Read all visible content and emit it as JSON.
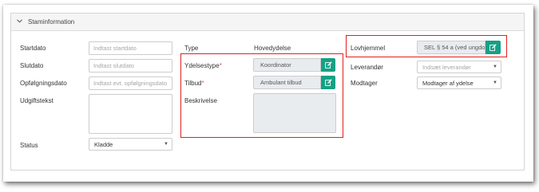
{
  "panel": {
    "title": "Staminformation"
  },
  "left": {
    "startdato": {
      "label": "Startdato",
      "placeholder": "Indtast startdato"
    },
    "slutdato": {
      "label": "Slutdato",
      "placeholder": "Indtast slutdato"
    },
    "opfolgning": {
      "label": "Opfølgningsdato",
      "placeholder": "Indtast evt. opfølgningsdato"
    },
    "udgiftstekst": {
      "label": "Udgiftstekst"
    },
    "status": {
      "label": "Status",
      "value": "Kladde"
    }
  },
  "middle": {
    "type": {
      "label": "Type",
      "value": "Hovedydelse"
    },
    "ydelsestype": {
      "label": "Ydelsestype",
      "required": "*",
      "value": "Koordinator"
    },
    "tilbud": {
      "label": "Tilbud",
      "required": "*",
      "value": "Ambulant tilbud"
    },
    "beskrivelse": {
      "label": "Beskrivelse"
    }
  },
  "right": {
    "lovhjemmel": {
      "label": "Lovhjemmel",
      "value": "SEL § 54 a (ved ungdom"
    },
    "leverandor": {
      "label": "Leverandør",
      "placeholder": "Indsæt leverandør"
    },
    "modtager": {
      "label": "Modtager",
      "value": "Modtager af ydelse"
    }
  },
  "colors": {
    "accent": "#16a085",
    "highlight": "#e02020",
    "readonly_bg": "#e9ecef"
  },
  "icons": {
    "collapse": "chevron-down-icon",
    "edit": "edit-icon",
    "dropdown": "caret-down-icon"
  }
}
